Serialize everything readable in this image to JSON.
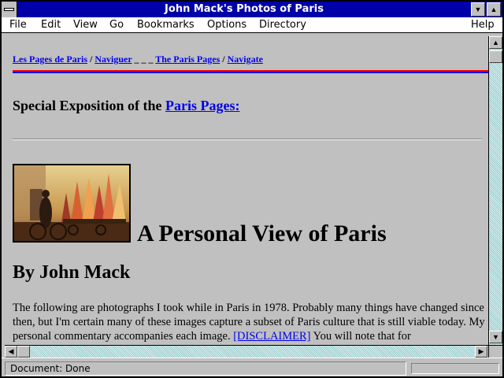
{
  "window": {
    "title": "John Mack's Photos of Paris"
  },
  "menu": {
    "items": [
      {
        "label": "File"
      },
      {
        "label": "Edit"
      },
      {
        "label": "View"
      },
      {
        "label": "Go"
      },
      {
        "label": "Bookmarks"
      },
      {
        "label": "Options"
      },
      {
        "label": "Directory"
      },
      {
        "label": "Help"
      }
    ]
  },
  "nav": {
    "link1": "Les Pages de Paris",
    "sep1": " / ",
    "link2": "Naviguer",
    "sep2": " _ _ _ ",
    "link3": "The Paris Pages",
    "sep3": " / ",
    "link4": "Navigate"
  },
  "special": {
    "text": "Special Exposition of the ",
    "link": "Paris Pages:"
  },
  "heading": "A Personal View of Paris",
  "byline": "By John Mack",
  "paragraph": {
    "text1": "The following are photographs I took while in Paris in 1978. Probably many things have changed since then, but I'm certain many of these images capture a subset of Paris culture that is still viable today. My personal commentary accompanies each image. ",
    "disclaimer": "[DISCLAIMER]",
    "text2": " You will note that for"
  },
  "status": {
    "text": "Document: Done"
  },
  "icons": {
    "system_menu": "system-menu-icon",
    "minimize": "minimize-icon",
    "maximize": "maximize-icon",
    "scroll_up": "arrow-up-icon",
    "scroll_down": "arrow-down-icon",
    "scroll_left": "arrow-left-icon",
    "scroll_right": "arrow-right-icon"
  },
  "colors": {
    "titlebar": "#0000a8",
    "link": "#0000ee",
    "rule_red": "#ff0000",
    "rule_blue": "#0000ff",
    "background": "#c0c0c0"
  }
}
